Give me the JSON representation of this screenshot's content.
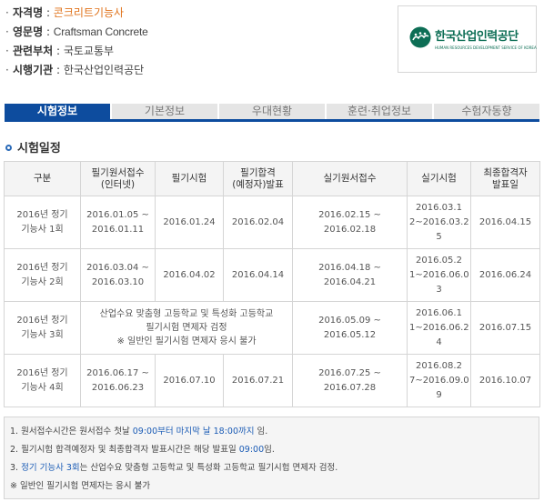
{
  "info": {
    "rows": [
      {
        "label": "자격명",
        "value": "콘크리트기능사"
      },
      {
        "label": "영문명",
        "value": "Craftsman Concrete"
      },
      {
        "label": "관련부처",
        "value": "국토교통부"
      },
      {
        "label": "시행기관",
        "value": "한국산업인력공단"
      }
    ],
    "bullet": "·",
    "separator": " : "
  },
  "logo": {
    "title": "한국산업인력공단",
    "subtitle": "HUMAN RESOURCES DEVELOPMENT SERVICE OF KOREA"
  },
  "tabs": [
    {
      "label": "시험정보",
      "active": true
    },
    {
      "label": "기본정보",
      "active": false
    },
    {
      "label": "우대현황",
      "active": false
    },
    {
      "label": "훈련·취업정보",
      "active": false
    },
    {
      "label": "수험자동향",
      "active": false
    }
  ],
  "section": {
    "title": "시험일정"
  },
  "schedule": {
    "headers": [
      "구분",
      "필기원서접수\n(인터넷)",
      "필기시험",
      "필기합격\n(예정자)발표",
      "실기원서접수",
      "실기시험",
      "최종합격자\n발표일"
    ],
    "rows": [
      {
        "round": "2016년 정기\n기능사 1회",
        "written_apply": "2016.01.05 ~\n2016.01.11",
        "written_exam": "2016.01.24",
        "written_result": "2016.02.04",
        "practical_apply": "2016.02.15 ~ 2016.02.18",
        "practical_exam": "2016.03.1\n2~2016.03.2\n5",
        "final_result": "2016.04.15"
      },
      {
        "round": "2016년 정기\n기능사 2회",
        "written_apply": "2016.03.04 ~\n2016.03.10",
        "written_exam": "2016.04.02",
        "written_result": "2016.04.14",
        "practical_apply": "2016.04.18 ~ 2016.04.21",
        "practical_exam": "2016.05.2\n1~2016.06.0\n3",
        "final_result": "2016.06.24"
      },
      {
        "round": "2016년 정기\n기능사 3회",
        "notice": "산업수요 맞춤형 고등학교 및 특성화 고등학교\n필기시험 면제자 검정\n※ 일반인 필기시험 면제자 응시 불가",
        "practical_apply": "2016.05.09 ~ 2016.05.12",
        "practical_exam": "2016.06.1\n1~2016.06.2\n4",
        "final_result": "2016.07.15"
      },
      {
        "round": "2016년 정기\n기능사 4회",
        "written_apply": "2016.06.17 ~\n2016.06.23",
        "written_exam": "2016.07.10",
        "written_result": "2016.07.21",
        "practical_apply": "2016.07.25 ~ 2016.07.28",
        "practical_exam": "2016.08.2\n7~2016.09.0\n9",
        "final_result": "2016.10.07"
      }
    ]
  },
  "notes": {
    "line1": {
      "a": "1. 원서접수시간은 원서접수 첫날 ",
      "b": "09:00부터 마지막 날 18:00까지",
      "c": " 임."
    },
    "line2": {
      "a": "2. 필기시험 합격예정자 및 최종합격자 발표시간은 해당 발표일 ",
      "b": "09:00",
      "c": "임."
    },
    "line3": {
      "a": "3. ",
      "b": "정기 기능사 3회",
      "c": "는 산업수요 맞춤형 고등학교 및 특성화 고등학교 필기시험 면제자 검정."
    },
    "line4": "※ 일반인 필기시험 면제자는 응시 불가"
  },
  "colors": {
    "accent": "#e0731b",
    "tab_active": "#0d4c9e",
    "link_blue": "#1a5bb5",
    "logo_green": "#0d6e55"
  }
}
